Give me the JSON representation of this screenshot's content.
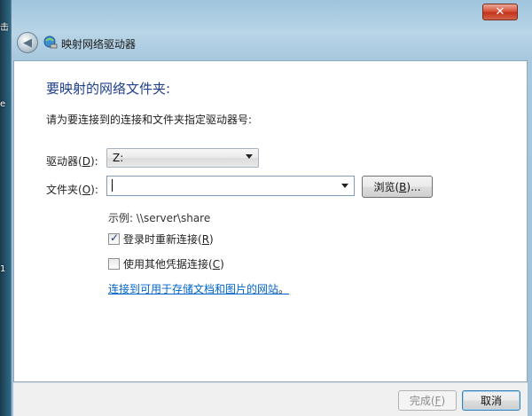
{
  "desktop": {
    "labels": [
      "击",
      "e",
      "1"
    ]
  },
  "window": {
    "title": "映射网络驱动器",
    "close_label": "✕"
  },
  "content": {
    "heading": "要映射的网络文件夹:",
    "instruction": "请为要连接到的连接和文件夹指定驱动器号:",
    "drive": {
      "label_prefix": "驱动器(",
      "label_key": "D",
      "label_suffix": "):",
      "value": "Z:"
    },
    "folder": {
      "label_prefix": "文件夹(",
      "label_key": "O",
      "label_suffix": "):",
      "value": ""
    },
    "browse": {
      "label_prefix": "浏览(",
      "label_key": "B",
      "label_suffix": ")..."
    },
    "example": "示例: \\\\server\\share",
    "reconnect": {
      "prefix": "登录时重新连接(",
      "key": "R",
      "suffix": ")",
      "checked": true
    },
    "other_credentials": {
      "prefix": "使用其他凭据连接(",
      "key": "C",
      "suffix": ")",
      "checked": false
    },
    "link": {
      "text": "连接到可用于存储文档和图片的网站",
      "trailing": "。"
    }
  },
  "footer": {
    "finish": {
      "prefix": "完成(",
      "key": "F",
      "suffix": ")"
    },
    "cancel": "取消"
  },
  "colors": {
    "heading": "#1e3f8c",
    "link": "#0066cc"
  }
}
